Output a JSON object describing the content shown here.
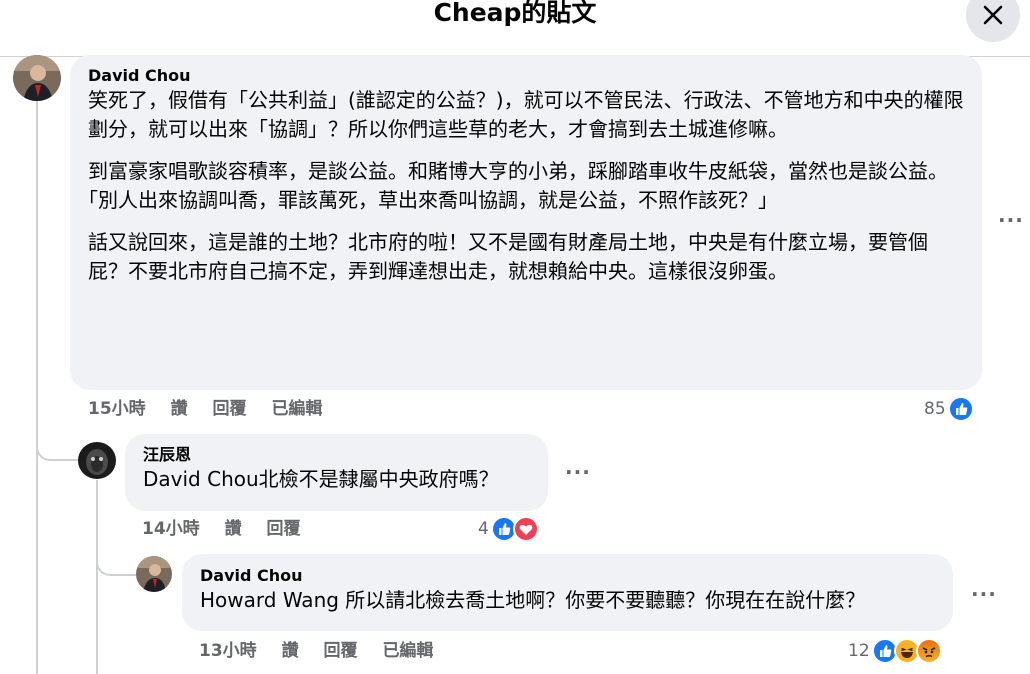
{
  "header": {
    "title": "Cheap的貼文",
    "close_icon": "close-icon"
  },
  "comment1": {
    "author": "David Chou",
    "paragraphs": [
      "笑死了，假借有「公共利益」(誰認定的公益？)，就可以不管民法、行政法、不管地方和中央的權限劃分，就可以出來「協調」？所以你們這些草的老大，才會搞到去土城進修嘛。",
      "到富豪家唱歌談容積率，是談公益。和賭博大亨的小弟，踩腳踏車收牛皮紙袋，當然也是談公益。｢別人出來協調叫喬，罪該萬死，草出來喬叫協調，就是公益，不照作該死？」",
      "話又說回來，這是誰的土地？北市府的啦！又不是國有財產局土地，中央是有什麼立場，要管個屁？不要北市府自己搞不定，弄到輝達想出走，就想賴給中央。這樣很沒卵蛋。"
    ],
    "time": "15小時",
    "like": "讚",
    "reply": "回覆",
    "edited": "已編輯",
    "reaction_count": "85",
    "reaction_icons": [
      "like-icon"
    ]
  },
  "comment2": {
    "author": "汪辰恩",
    "text": "David Chou北檢不是隸屬中央政府嗎？",
    "time": "14小時",
    "like": "讚",
    "reply": "回覆",
    "reaction_count": "4",
    "reaction_icons": [
      "like-icon",
      "love-icon"
    ]
  },
  "comment3": {
    "author": "David Chou",
    "text": "Howard Wang 所以請北檢去喬土地啊？你要不要聽聽？你現在在說什麼？",
    "time": "13小時",
    "like": "讚",
    "reply": "回覆",
    "edited": "已編輯",
    "reaction_count": "12",
    "reaction_icons": [
      "like-icon",
      "haha-icon",
      "angry-icon"
    ]
  },
  "colors": {
    "bubble": "#f0f2f5",
    "meta_text": "#65676b",
    "like_blue": "#1877f2",
    "love_red": "#f33e58",
    "haha_yellow": "#f7b125",
    "thread_line": "#ced0d4"
  }
}
